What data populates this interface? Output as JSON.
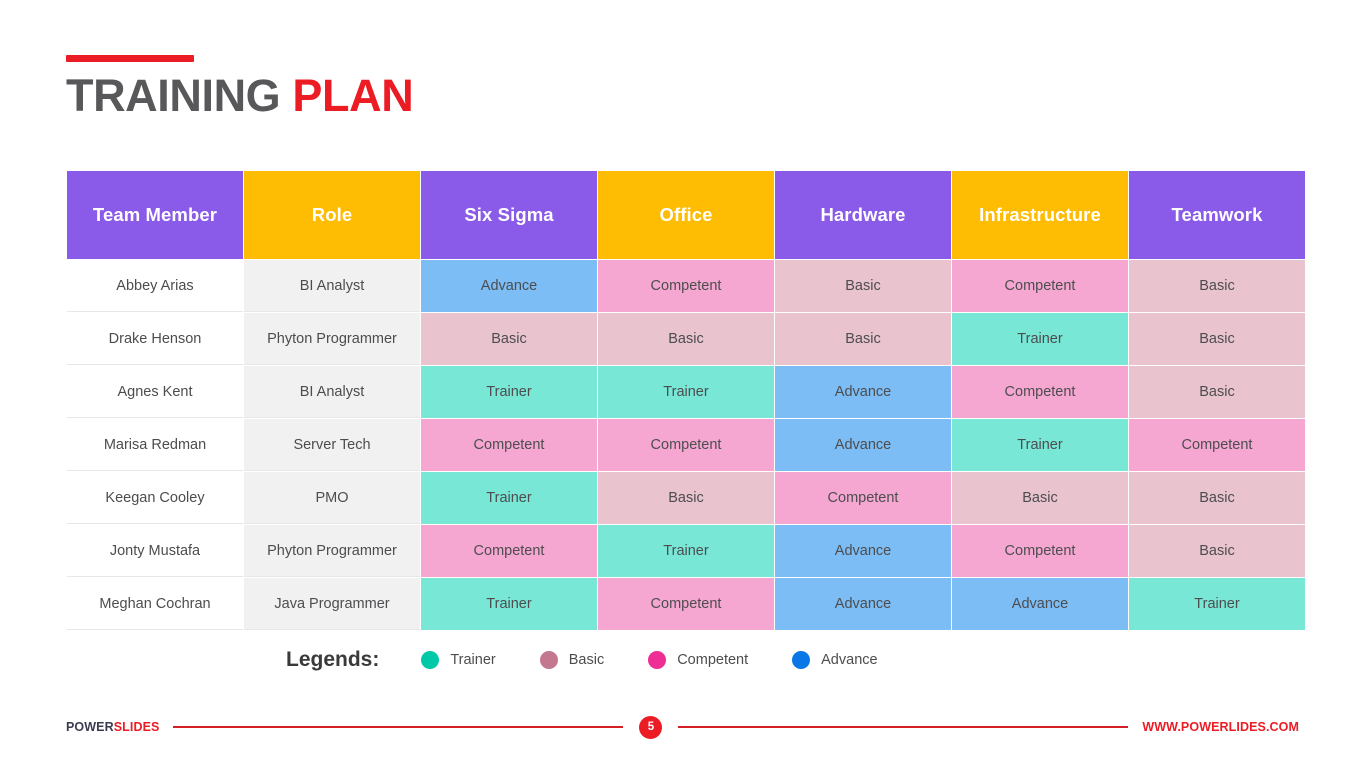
{
  "title": {
    "primary": "TRAINING ",
    "accent": "PLAN",
    "rule_color": "#ec1c24",
    "primary_color": "#58585b"
  },
  "table": {
    "columns": [
      {
        "label": "Team Member",
        "header_color": "#8a5ae8",
        "kind": "name"
      },
      {
        "label": "Role",
        "header_color": "#febc02",
        "kind": "role"
      },
      {
        "label": "Six Sigma",
        "header_color": "#8a5ae8",
        "kind": "skill"
      },
      {
        "label": "Office",
        "header_color": "#febc02",
        "kind": "skill"
      },
      {
        "label": "Hardware",
        "header_color": "#8a5ae8",
        "kind": "skill"
      },
      {
        "label": "Infrastructure",
        "header_color": "#febc02",
        "kind": "skill"
      },
      {
        "label": "Teamwork",
        "header_color": "#8a5ae8",
        "kind": "skill"
      }
    ],
    "rows": [
      {
        "name": "Abbey Arias",
        "role": "BI Analyst",
        "skills": [
          "Advance",
          "Competent",
          "Basic",
          "Competent",
          "Basic"
        ]
      },
      {
        "name": "Drake Henson",
        "role": "Phyton Programmer",
        "skills": [
          "Basic",
          "Basic",
          "Basic",
          "Trainer",
          "Basic"
        ]
      },
      {
        "name": "Agnes Kent",
        "role": "BI Analyst",
        "skills": [
          "Trainer",
          "Trainer",
          "Advance",
          "Competent",
          "Basic"
        ]
      },
      {
        "name": "Marisa Redman",
        "role": "Server Tech",
        "skills": [
          "Competent",
          "Competent",
          "Advance",
          "Trainer",
          "Competent"
        ]
      },
      {
        "name": "Keegan Cooley",
        "role": "PMO",
        "skills": [
          "Trainer",
          "Basic",
          "Competent",
          "Basic",
          "Basic"
        ]
      },
      {
        "name": "Jonty Mustafa",
        "role": "Phyton Programmer",
        "skills": [
          "Competent",
          "Trainer",
          "Advance",
          "Competent",
          "Basic"
        ]
      },
      {
        "name": "Meghan Cochran",
        "role": "Java Programmer",
        "skills": [
          "Trainer",
          "Competent",
          "Advance",
          "Advance",
          "Trainer"
        ]
      }
    ]
  },
  "level_colors": {
    "Trainer": "#79e7d6",
    "Basic": "#e9c3ce",
    "Competent": "#f5a7d1",
    "Advance": "#7cbdf5"
  },
  "legends": {
    "label": "Legends:",
    "items": [
      {
        "label": "Trainer",
        "dot_color": "#00c9a7"
      },
      {
        "label": "Basic",
        "dot_color": "#c4788f"
      },
      {
        "label": "Competent",
        "dot_color": "#ee2e95"
      },
      {
        "label": "Advance",
        "dot_color": "#0a77e8"
      }
    ]
  },
  "footer": {
    "brand_primary": "POWER",
    "brand_accent": "SLIDES",
    "page_number": "5",
    "url": "WWW.POWERLIDES.COM",
    "accent_color": "#ec1c24"
  }
}
